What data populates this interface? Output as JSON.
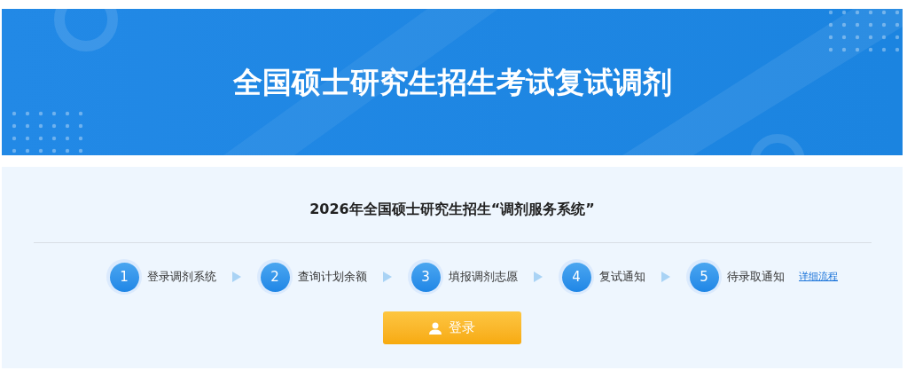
{
  "banner": {
    "title": "全国硕士研究生招生考试复试调剂"
  },
  "panel": {
    "heading": "2026年全国硕士研究生招生“调剂服务系统”",
    "steps": [
      {
        "number": "1",
        "label": "登录调剂系统"
      },
      {
        "number": "2",
        "label": "查询计划余额"
      },
      {
        "number": "3",
        "label": "填报调剂志愿"
      },
      {
        "number": "4",
        "label": "复试通知"
      },
      {
        "number": "5",
        "label": "待录取通知"
      }
    ],
    "link": "详细流程",
    "login_button": "登录"
  }
}
